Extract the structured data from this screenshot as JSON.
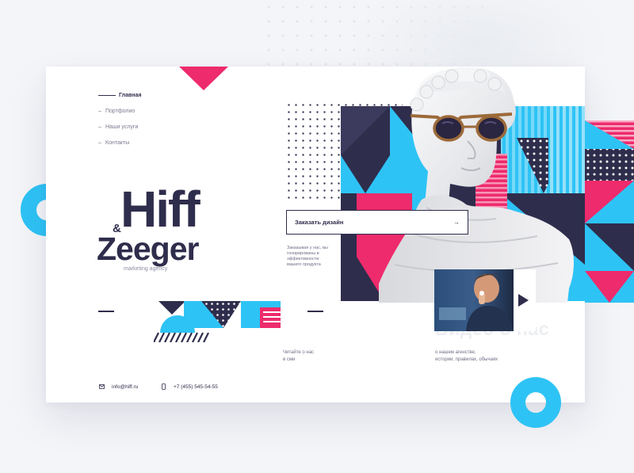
{
  "colors": {
    "navy": "#2f2d4c",
    "cyan": "#2ec3f5",
    "pink": "#ee2b6c",
    "white": "#ffffff"
  },
  "nav": {
    "items": [
      {
        "label": "Главная",
        "active": true
      },
      {
        "label": "Портфолио",
        "active": false
      },
      {
        "label": "Наши услуги",
        "active": false
      },
      {
        "label": "Контакты",
        "active": false
      }
    ]
  },
  "logo": {
    "amp": "&",
    "line1": "Hiff",
    "line2": "Zeeger",
    "tagline": "marketing agency"
  },
  "cta": {
    "label": "Заказать дизайн",
    "arrow_icon": "arrow-right-icon",
    "description": "Заказывая у нас, вы гонорированы в эффективности вашего продукта"
  },
  "video": {
    "title": "Видео о нас",
    "description_line1": "о нашем агенстве,",
    "description_line2": "истории, правилах, обычаях",
    "play_icon": "play-icon"
  },
  "press": {
    "line1": "Читайте о нас",
    "line2": "в сми"
  },
  "footer": {
    "email": "info@hiff.ru",
    "email_icon": "mail-icon",
    "phone": "+7 (455) 545-54-55",
    "phone_icon": "phone-icon"
  }
}
